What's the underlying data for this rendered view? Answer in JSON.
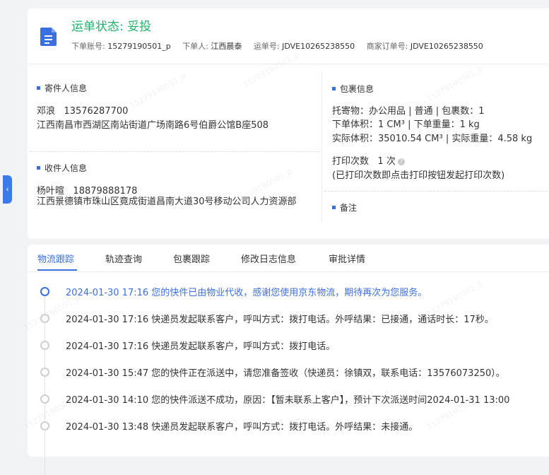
{
  "header": {
    "status_title": "运单状态: 妥投",
    "order_account_label": "下单账号:",
    "order_account": "15279190501_p",
    "orderer_label": "下单人:",
    "orderer": "江西晨泰",
    "waybill_label": "运单号:",
    "waybill_no": "JDVE10265238550",
    "merchant_order_label": "商家订单号:",
    "merchant_order_no": "JDVE10265238550"
  },
  "sender": {
    "title": "寄件人信息",
    "name": "邓浪",
    "phone": "13576287700",
    "address": "江西南昌市西湖区南站街道广场南路6号伯爵公馆B座508"
  },
  "receiver": {
    "title": "收件人信息",
    "name": "杨叶暄",
    "phone": "18879888178",
    "address": "江西景德镇市珠山区竟成街道昌南大道30号移动公司人力资源部"
  },
  "package": {
    "title": "包裹信息",
    "line1": "托寄物：办公用品 | 普通 | 包裹数：1",
    "line2_a": "下单体积：",
    "line2_vol": "1 CM³",
    "line2_b": " | 下单重量：",
    "line2_wt": "1 kg",
    "line3_a": "实际体积：",
    "line3_vol": "35010.54 CM³",
    "line3_b": " | 实际重量：",
    "line3_wt": "4.58 kg",
    "print_label": "打印次数",
    "print_count": "1 次",
    "print_hint": "(已打印次数即点击打印按钮发起打印次数)"
  },
  "remark": {
    "title": "备注"
  },
  "tabs": [
    "物流跟踪",
    "轨迹查询",
    "包裹跟踪",
    "修改日志信息",
    "审批详情"
  ],
  "timeline": [
    {
      "text": "2024-01-30 17:16 您的快件已由物业代收，感谢您使用京东物流，期待再次为您服务。"
    },
    {
      "text": "2024-01-30 17:16 快递员发起联系客户，呼叫方式：拨打电话。外呼结果：已接通，通话时长：17秒。"
    },
    {
      "text": "2024-01-30 17:16 快递员发起联系客户，呼叫方式：拨打电话。"
    },
    {
      "text": "2024-01-30 15:47 您的快件正在派送中，请您准备签收（快递员：徐镇双，联系电话：13576073250）。"
    },
    {
      "text": "2024-01-30 14:10 您的快件派送不成功，原因：【暂未联系上客户】，预计下次派送时间2024-01-31 13:00"
    },
    {
      "text": "2024-01-30 13:48 快递员发起联系客户，呼叫方式：拨打电话。外呼结果：未接通。"
    }
  ],
  "watermark": "15279190501_p",
  "colors": {
    "status_green": "#21b36b",
    "accent_blue": "#3a6fe0"
  }
}
